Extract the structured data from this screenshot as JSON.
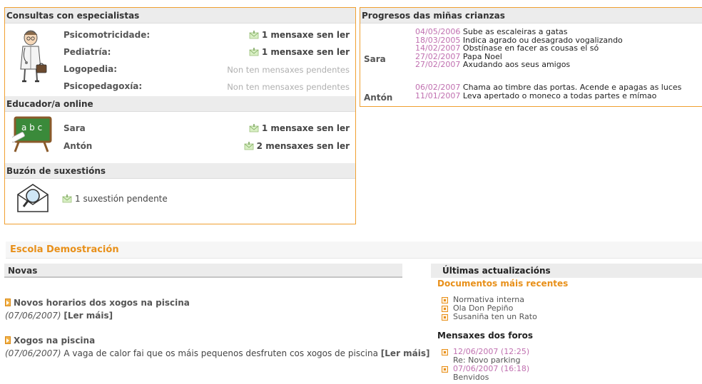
{
  "specialists": {
    "title": "Consultas con especialistas",
    "rows": [
      {
        "label": "Psicomotricidade:",
        "status": "1 mensaxe sen ler",
        "unread": true
      },
      {
        "label": "Pediatría:",
        "status": "1 mensaxe sen ler",
        "unread": true
      },
      {
        "label": "Logopedia:",
        "status": "Non ten mensaxes pendentes",
        "unread": false
      },
      {
        "label": "Psicopedagoxía:",
        "status": "Non ten mensaxes pendentes",
        "unread": false
      }
    ]
  },
  "educator": {
    "title": "Educador/a online",
    "board_text": "a b c",
    "rows": [
      {
        "label": "Sara",
        "status": "1 mensaxe sen ler"
      },
      {
        "label": "Antón",
        "status": "2 mensaxes sen ler"
      }
    ]
  },
  "suggestions": {
    "title": "Buzón de suxestións",
    "status": "1 suxestión pendente"
  },
  "progress": {
    "title": "Progresos das miñas crianzas",
    "children": [
      {
        "name": "Sara",
        "entries": [
          {
            "date": "04/05/2006",
            "text": "Sube as escaleiras a gatas"
          },
          {
            "date": "18/03/2005",
            "text": "Indica agrado ou desagrado vogalizando"
          },
          {
            "date": "14/02/2007",
            "text": "Obstínase en facer as cousas el só"
          },
          {
            "date": "27/02/2007",
            "text": "Papa Noel"
          },
          {
            "date": "27/02/2007",
            "text": "Axudando aos seus amigos"
          }
        ]
      },
      {
        "name": "Antón",
        "entries": [
          {
            "date": "06/02/2007",
            "text": "Chama ao timbre das portas. Acende e apagas as luces"
          },
          {
            "date": "11/01/2007",
            "text": "Leva apertado o moneco a todas partes e mímao"
          }
        ]
      }
    ]
  },
  "school": {
    "title": "Escola Demostración"
  },
  "news": {
    "title": "Novas",
    "items": [
      {
        "title": "Novos horarios dos xogos na piscina",
        "date": "(07/06/2007)",
        "body": "",
        "read_more": "[Ler máis]"
      },
      {
        "title": "Xogos na piscina",
        "date": "(07/06/2007)",
        "body": "A vaga de calor fai que os máis pequenos desfruten cos xogos de piscina",
        "read_more": "[Ler máis]"
      }
    ]
  },
  "updates": {
    "title": "Últimas actualizacións",
    "docs_title": "Documentos máis recentes",
    "docs": [
      "Normativa interna",
      "Ola Don Pepiño",
      "Susaniña ten un Rato"
    ],
    "forums_title": "Mensaxes dos foros",
    "forums": [
      {
        "date": "12/06/2007 (12:25)",
        "subject": "Re: Novo parking"
      },
      {
        "date": "07/06/2007 (16:18)",
        "subject": "Benvidos"
      }
    ]
  },
  "colors": {
    "accent": "#e8901a",
    "panel_border": "#f0a030",
    "date_pink": "#c070b0"
  }
}
